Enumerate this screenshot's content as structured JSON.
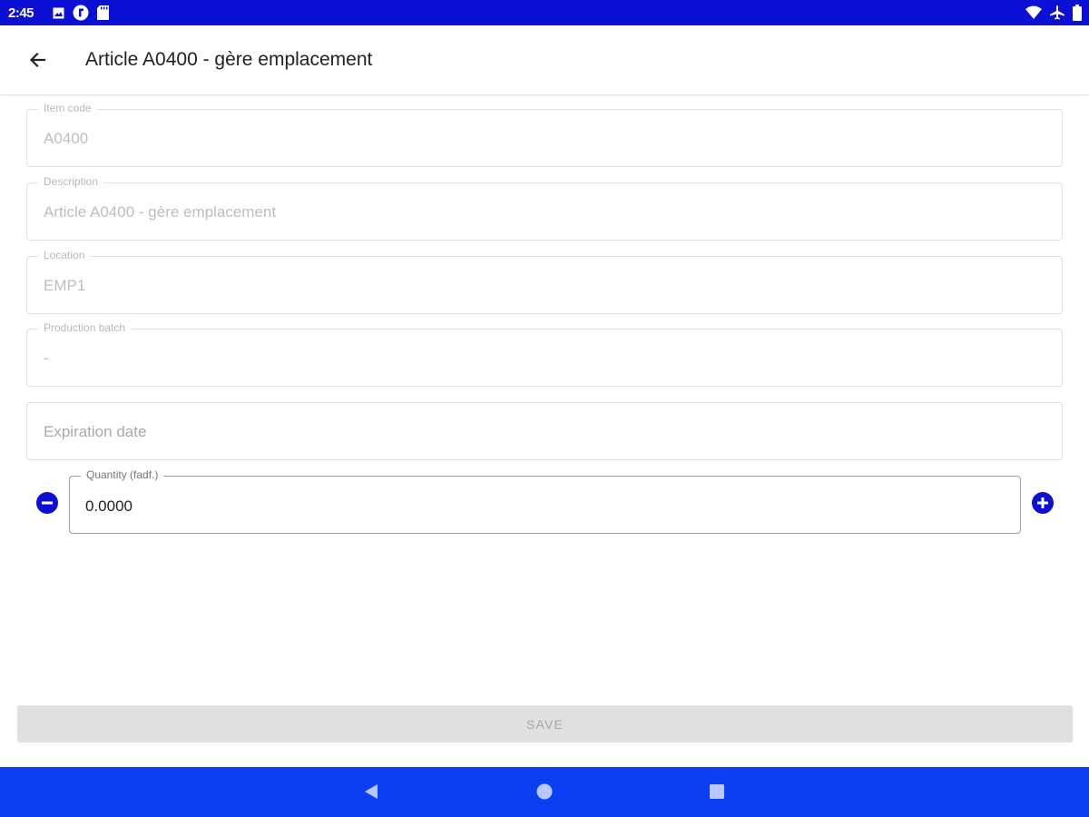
{
  "status_bar": {
    "time": "2:45",
    "left_icons": [
      "photo-notification-icon",
      "sync-notification-icon",
      "sd-card-icon"
    ],
    "right_icons": [
      "wifi-icon",
      "airplane-mode-icon",
      "battery-icon"
    ],
    "color": "#0c0fd4"
  },
  "app_bar": {
    "title": "Article A0400 - gère emplacement",
    "back_icon": "arrow-back-icon"
  },
  "form": {
    "item_code": {
      "label": "Item code",
      "value": "A0400"
    },
    "description": {
      "label": "Description",
      "value": "Article A0400 - gère emplacement"
    },
    "location": {
      "label": "Location",
      "value": "EMP1"
    },
    "production_batch": {
      "label": "Production batch",
      "value": "-"
    },
    "expiration_date": {
      "placeholder": "Expiration date"
    },
    "quantity": {
      "label": "Quantity (fadf.)",
      "value": "0.0000",
      "decrement_icon": "minus-circle-icon",
      "increment_icon": "plus-circle-icon"
    }
  },
  "save_button": {
    "label": "SAVE"
  },
  "nav_bar": {
    "color": "#0c3ef2",
    "icons": [
      "nav-back-icon",
      "nav-home-icon",
      "nav-recents-icon"
    ]
  }
}
